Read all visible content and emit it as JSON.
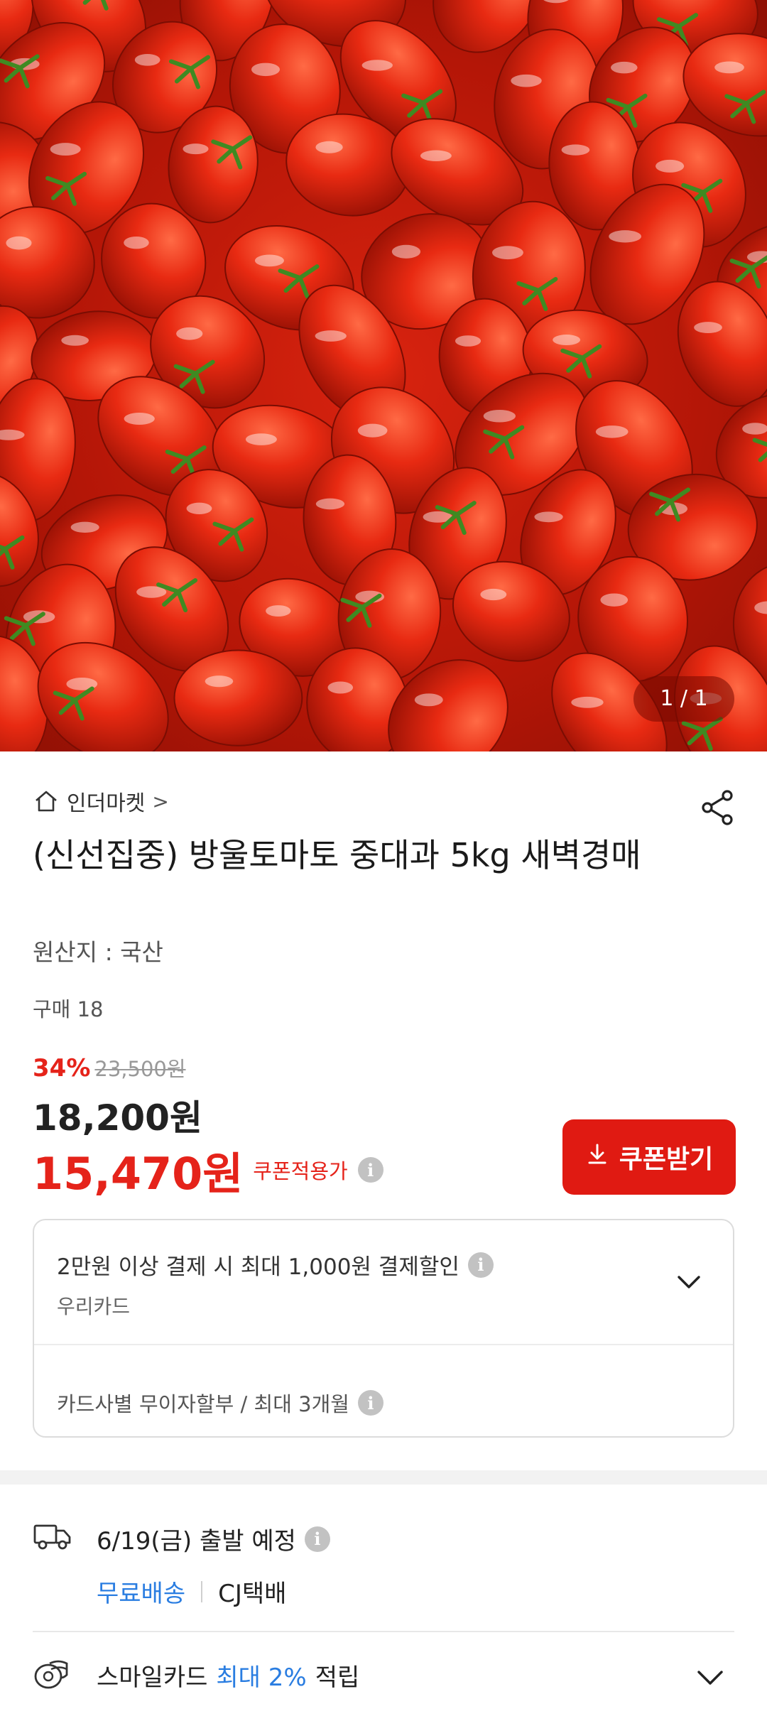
{
  "hero": {
    "image_desc": "",
    "counter": "1 / 1"
  },
  "store": {
    "icon": "home-icon",
    "name": "인더마켓",
    "chevron": ">"
  },
  "share_icon": "share-icon",
  "product": {
    "title": "(신선집중) 방울토마토 중대과 5kg 새벽경매",
    "origin": "원산지 : 국산",
    "purchase_count": "구매 18"
  },
  "price": {
    "discount_rate": "34%",
    "original_price": "23,500원",
    "sale_price": "18,200원",
    "coupon_price": "15,470원",
    "coupon_label": "쿠폰적용가",
    "coupon_button": "쿠폰받기"
  },
  "card_benefit": {
    "title": "2만원 이상 결제 시 최대 1,000원 결제할인",
    "card_name": "우리카드",
    "installment": "카드사별 무이자할부 / 최대 3개월"
  },
  "shipping": {
    "departure": "6/19(금) 출발 예정",
    "free_shipping": "무료배송",
    "courier": "CJ택배"
  },
  "smile_card": {
    "prefix": "스마일카드",
    "highlight": "최대 2%",
    "suffix": "적립"
  },
  "colors": {
    "accent_red": "#e5231a",
    "button_red": "#e01a12",
    "link_blue": "#2a7de1"
  }
}
